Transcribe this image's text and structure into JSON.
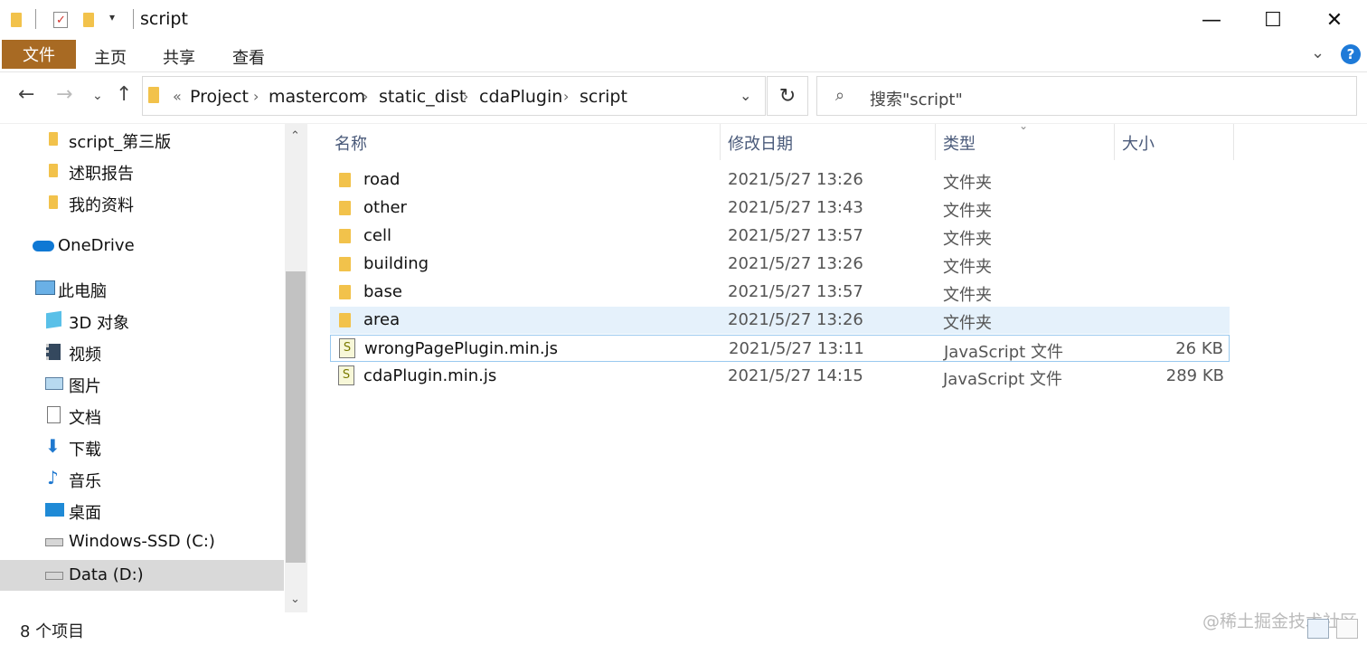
{
  "window": {
    "title": "script",
    "minimize": "—",
    "maximize": "☐",
    "close": "✕"
  },
  "ribbon": {
    "file": "文件",
    "tabs": [
      "主页",
      "共享",
      "查看"
    ],
    "help": "?"
  },
  "address": {
    "overflow": "«",
    "segments": [
      "Project",
      "mastercom",
      "static_dist",
      "cdaPlugin",
      "script"
    ]
  },
  "search": {
    "placeholder": "搜索\"script\""
  },
  "sidebar": {
    "items": [
      {
        "label": "script_第三版",
        "icon": "folder-icon"
      },
      {
        "label": "述职报告",
        "icon": "folder-icon"
      },
      {
        "label": "我的资料",
        "icon": "folder-icon"
      },
      {
        "label": "OneDrive",
        "icon": "cloud-icon"
      },
      {
        "label": "此电脑",
        "icon": "computer-icon"
      },
      {
        "label": "3D 对象",
        "icon": "cube-icon"
      },
      {
        "label": "视频",
        "icon": "film-icon"
      },
      {
        "label": "图片",
        "icon": "picture-icon"
      },
      {
        "label": "文档",
        "icon": "document-icon"
      },
      {
        "label": "下载",
        "icon": "download-icon"
      },
      {
        "label": "音乐",
        "icon": "music-icon"
      },
      {
        "label": "桌面",
        "icon": "desktop-icon"
      },
      {
        "label": "Windows-SSD (C:)",
        "icon": "drive-icon"
      },
      {
        "label": "Data (D:)",
        "icon": "drive-icon"
      }
    ]
  },
  "columns": [
    "名称",
    "修改日期",
    "类型",
    "大小"
  ],
  "files": [
    {
      "name": "road",
      "date": "2021/5/27 13:26",
      "type": "文件夹",
      "size": "",
      "icon": "folder-icon"
    },
    {
      "name": "other",
      "date": "2021/5/27 13:43",
      "type": "文件夹",
      "size": "",
      "icon": "folder-icon"
    },
    {
      "name": "cell",
      "date": "2021/5/27 13:57",
      "type": "文件夹",
      "size": "",
      "icon": "folder-icon"
    },
    {
      "name": "building",
      "date": "2021/5/27 13:26",
      "type": "文件夹",
      "size": "",
      "icon": "folder-icon"
    },
    {
      "name": "base",
      "date": "2021/5/27 13:57",
      "type": "文件夹",
      "size": "",
      "icon": "folder-icon"
    },
    {
      "name": "area",
      "date": "2021/5/27 13:26",
      "type": "文件夹",
      "size": "",
      "icon": "folder-icon"
    },
    {
      "name": "wrongPagePlugin.min.js",
      "date": "2021/5/27 13:11",
      "type": "JavaScript 文件",
      "size": "26 KB",
      "icon": "js-file-icon"
    },
    {
      "name": "cdaPlugin.min.js",
      "date": "2021/5/27 14:15",
      "type": "JavaScript 文件",
      "size": "289 KB",
      "icon": "js-file-icon"
    }
  ],
  "status": {
    "count": "8 个项目"
  },
  "watermark": "@稀土掘金技术社区"
}
